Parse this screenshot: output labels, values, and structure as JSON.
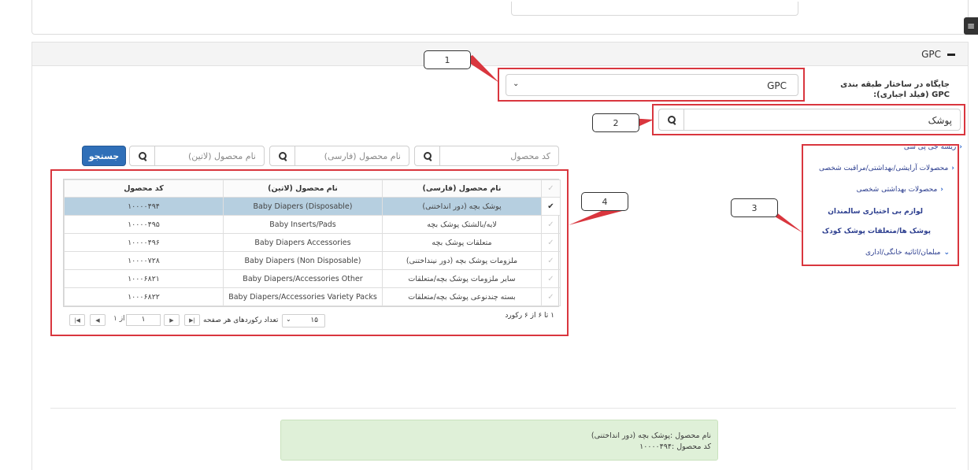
{
  "gpc_section": {
    "title": "GPC",
    "field_label": "جایگاه در ساختار طبقه بندی GPC (فیلد اجباری):",
    "select_value": "GPC",
    "tree_search_value": "پوشک"
  },
  "tree": {
    "items": [
      {
        "label": "ریشه جی پی سی"
      },
      {
        "label": "محصولات آرایشی/بهداشتی/مراقبت شخصی"
      },
      {
        "label": "محصولات بهداشتی شخصی"
      },
      {
        "label": "لوازم بی اختیاری سالمندان"
      },
      {
        "label": "پوشک ها/متعلقات پوشک کودک"
      },
      {
        "label": "مبلمان/اثاثیه خانگی/اداری"
      }
    ]
  },
  "search": {
    "code_placeholder": "کد محصول",
    "name_fa_placeholder": "نام محصول (فارسی)",
    "name_en_placeholder": "نام محصول (لاتین)",
    "button_label": "جستجو"
  },
  "grid": {
    "columns": [
      "نام محصول (فارسی)",
      "نام محصول (لاتین)",
      "کد محصول"
    ],
    "rows": [
      {
        "fa": "پوشک بچه (دور انداختنی)",
        "en": "Baby Diapers (Disposable)",
        "code": "۱۰۰۰۰۴۹۴",
        "checked": "✔"
      },
      {
        "fa": "لایه/بالشتک پوشک بچه",
        "en": "Baby Inserts/Pads",
        "code": "۱۰۰۰۰۴۹۵",
        "checked": "✓"
      },
      {
        "fa": "متعلقات پوشک بچه",
        "en": "Baby Diapers Accessories",
        "code": "۱۰۰۰۰۴۹۶",
        "checked": "✓"
      },
      {
        "fa": "ملزومات پوشک بچه (دور نینداختنی)",
        "en": "Baby Diapers (Non Disposable)",
        "code": "۱۰۰۰۰۷۲۸",
        "checked": "✓"
      },
      {
        "fa": "سایر ملزومات پوشک بچه/متعلقات",
        "en": "Baby Diapers/Accessories Other",
        "code": "۱۰۰۰۶۸۲۱",
        "checked": "✓"
      },
      {
        "fa": "بسته چندنوعی پوشک بچه/متعلقات",
        "en": "Baby Diapers/Accessories Variety Packs",
        "code": "۱۰۰۰۶۸۲۲",
        "checked": "✓"
      }
    ],
    "pager": {
      "info": "۱ تا ۶ از ۶ رکورد",
      "page_size_label": "تعداد رکوردهای هر صفحه",
      "page_size": "۱۵",
      "page_input": "۱",
      "page_of": "از ۱"
    }
  },
  "selection_info": {
    "name_line": "نام محصول :پوشک بچه (دور انداختنی)",
    "code_line": "کد محصول :۱۰۰۰۰۴۹۴"
  },
  "callouts": [
    "1",
    "2",
    "3",
    "4"
  ],
  "colors": {
    "annotation_red": "#d9363e",
    "primary_blue": "#2f6fb8",
    "selected_row": "#b6cfe0",
    "success_bg": "#dff0d8"
  }
}
